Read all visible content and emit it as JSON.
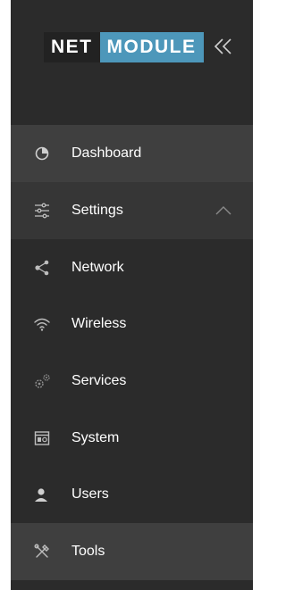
{
  "logo": {
    "part1": "NET",
    "part2": "MODULE"
  },
  "collapse_icon": "double-chevron-left-icon",
  "nav": {
    "dashboard": {
      "label": "Dashboard",
      "icon": "pie-chart-icon"
    },
    "settings": {
      "label": "Settings",
      "icon": "sliders-icon",
      "expanded_icon": "chevron-up-icon"
    },
    "network": {
      "label": "Network",
      "icon": "share-icon"
    },
    "wireless": {
      "label": "Wireless",
      "icon": "wifi-icon"
    },
    "services": {
      "label": "Services",
      "icon": "gears-icon"
    },
    "system": {
      "label": "System",
      "icon": "system-window-icon"
    },
    "users": {
      "label": "Users",
      "icon": "user-icon"
    },
    "tools": {
      "label": "Tools",
      "icon": "tools-icon"
    }
  },
  "colors": {
    "sidebar_bg": "#2b2b2b",
    "highlight": "#3f3f3f",
    "accent": "#4d97ba",
    "icon": "#bdbdbd"
  }
}
